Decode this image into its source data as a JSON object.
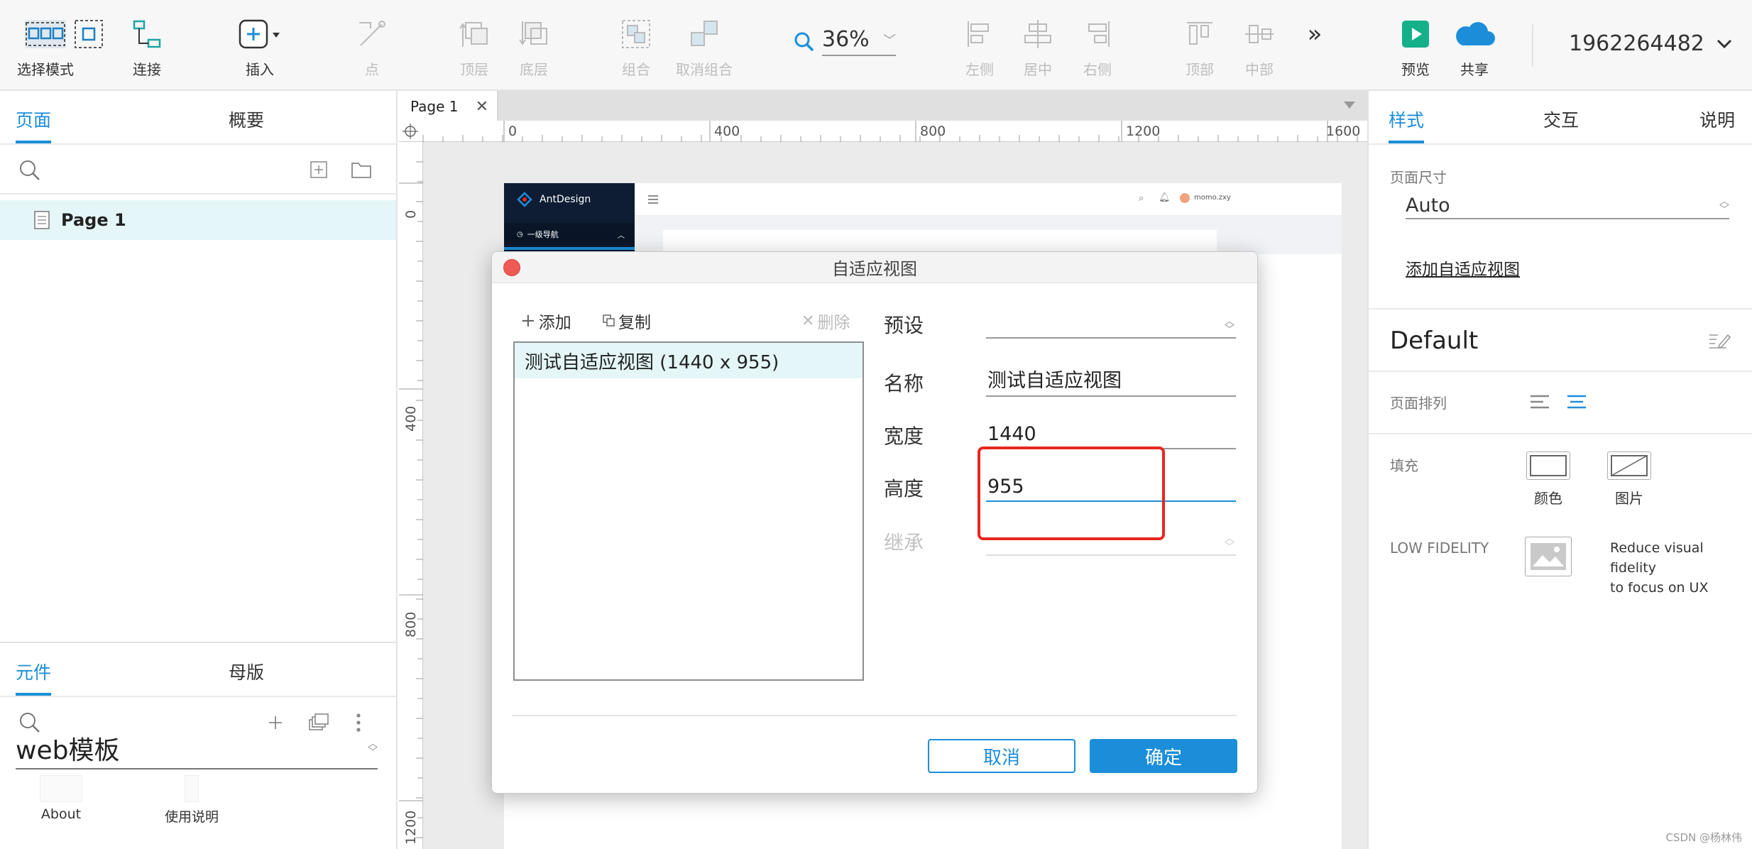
{
  "toolbar": {
    "select_mode": "选择模式",
    "connect": "连接",
    "insert": "插入",
    "point": "点",
    "top_layer": "顶层",
    "bottom_layer": "底层",
    "group": "组合",
    "ungroup": "取消组合",
    "zoom": "36%",
    "align_left": "左侧",
    "align_center": "居中",
    "align_right": "右侧",
    "align_top": "顶部",
    "align_middle": "中部",
    "more": "»",
    "preview": "预览",
    "share": "共享",
    "user_id": "1962264482"
  },
  "left_panel": {
    "tab_pages": "页面",
    "tab_outline": "概要",
    "page_item": "Page 1",
    "tab_widgets": "元件",
    "tab_masters": "母版",
    "library_name": "web模板",
    "thumbs": [
      "About",
      "使用说明"
    ]
  },
  "canvas": {
    "page_tab": "Page 1",
    "ruler_h": [
      "0",
      "400",
      "800",
      "1200",
      "1600"
    ],
    "ruler_v": [
      "0",
      "400",
      "800",
      "1200"
    ],
    "preview": {
      "brand": "AntDesign",
      "nav_item": "一级导航",
      "user": "momo.zxy"
    }
  },
  "right_panel": {
    "tab_style": "样式",
    "tab_interaction": "交互",
    "tab_notes": "说明",
    "page_size_label": "页面尺寸",
    "page_size_value": "Auto",
    "add_adaptive_view": "添加自适应视图",
    "style_name": "Default",
    "page_align_label": "页面排列",
    "fill_label": "填充",
    "fill_color": "颜色",
    "fill_image": "图片",
    "low_fidelity_label": "LOW FIDELITY",
    "low_fidelity_desc_1": "Reduce visual fidelity",
    "low_fidelity_desc_2": "to focus on UX"
  },
  "dialog": {
    "title": "自适应视图",
    "add": "添加",
    "copy": "复制",
    "delete": "删除",
    "views": [
      "测试自适应视图 (1440 x 955)"
    ],
    "preset_label": "预设",
    "preset_value": "",
    "name_label": "名称",
    "name_value": "测试自适应视图",
    "width_label": "宽度",
    "width_value": "1440",
    "height_label": "高度",
    "height_value": "955",
    "inherit_label": "继承",
    "cancel": "取消",
    "ok": "确定"
  },
  "watermark": "CSDN @杨林伟",
  "colors": {
    "accent": "#1c8ed9",
    "highlight": "#e8271f",
    "close": "#ee5b55",
    "selection": "#e4f6f8"
  }
}
